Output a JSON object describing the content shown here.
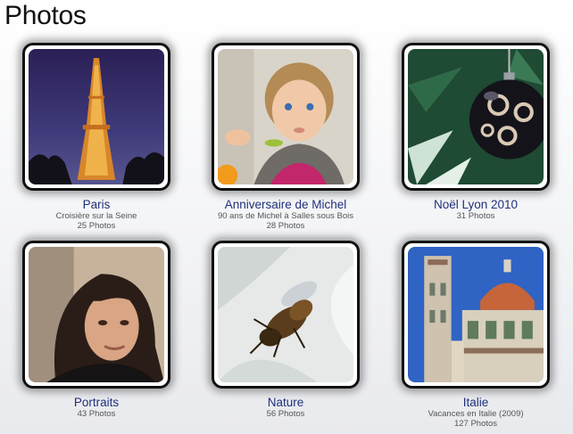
{
  "page": {
    "title": "Photos"
  },
  "albums": [
    {
      "title": "Paris",
      "subtitle": "Croisière sur la Seine",
      "count": "25 Photos",
      "thumb": "eiffel-tower-night-image"
    },
    {
      "title": "Anniversaire de Michel",
      "subtitle": "90 ans de Michel à Salles sous Bois",
      "count": "28 Photos",
      "thumb": "baby-portrait-image"
    },
    {
      "title": "Noël Lyon 2010",
      "subtitle": "",
      "count": "31 Photos",
      "thumb": "christmas-ornament-image"
    },
    {
      "title": "Portraits",
      "subtitle": "",
      "count": "43 Photos",
      "thumb": "woman-portrait-image"
    },
    {
      "title": "Nature",
      "subtitle": "",
      "count": "56 Photos",
      "thumb": "bee-on-petal-image"
    },
    {
      "title": "Italie",
      "subtitle": "Vacances en Italie (2009)",
      "count": "127 Photos",
      "thumb": "florence-cathedral-image"
    }
  ]
}
